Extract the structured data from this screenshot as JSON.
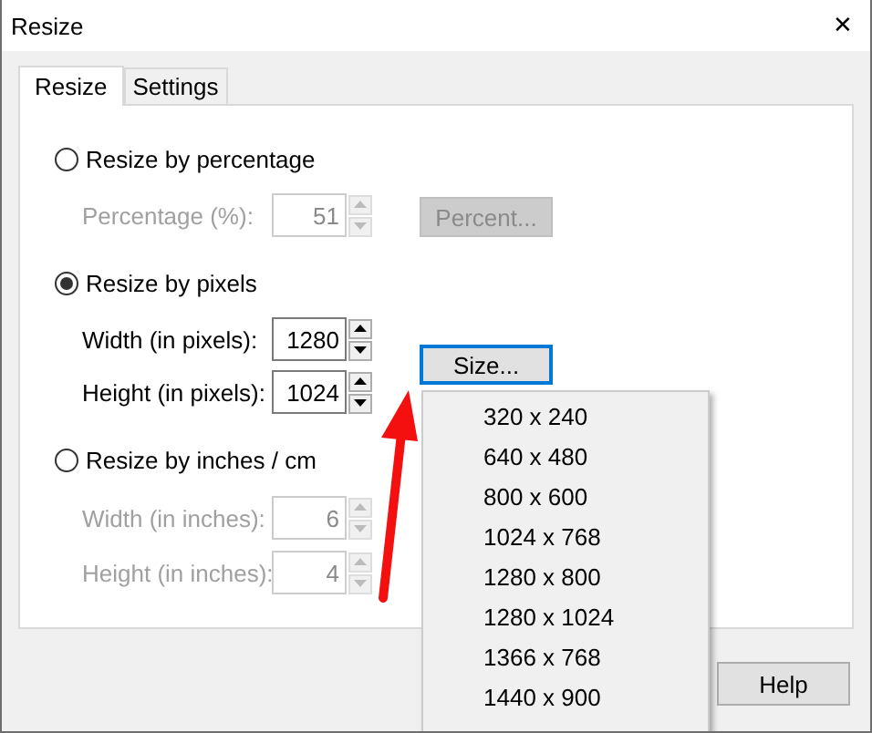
{
  "window": {
    "title": "Resize",
    "close": "✕"
  },
  "tabs": [
    {
      "label": "Resize",
      "selected": true
    },
    {
      "label": "Settings",
      "selected": false
    }
  ],
  "options": [
    {
      "label": "Resize by percentage",
      "selected": false,
      "fields": [
        {
          "label": "Percentage (%):",
          "value": "51"
        }
      ],
      "button": {
        "label": "Percent...",
        "disabled": true,
        "focused": false
      }
    },
    {
      "label": "Resize by pixels",
      "selected": true,
      "fields": [
        {
          "label": "Width (in pixels):",
          "value": "1280"
        },
        {
          "label": "Height (in pixels):",
          "value": "1024"
        }
      ],
      "button": {
        "label": "Size...",
        "disabled": false,
        "focused": true
      }
    },
    {
      "label": "Resize by inches / cm",
      "selected": false,
      "fields": [
        {
          "label": "Width (in inches):",
          "value": "6"
        },
        {
          "label": "Height (in inches):",
          "value": "4"
        }
      ]
    }
  ],
  "size_menu": {
    "items": [
      "320 x 240",
      "640 x 480",
      "800 x 600",
      "1024 x 768",
      "1280 x 800",
      "1280 x 1024",
      "1366 x 768",
      "1440 x 900"
    ]
  },
  "help_button": "Help"
}
